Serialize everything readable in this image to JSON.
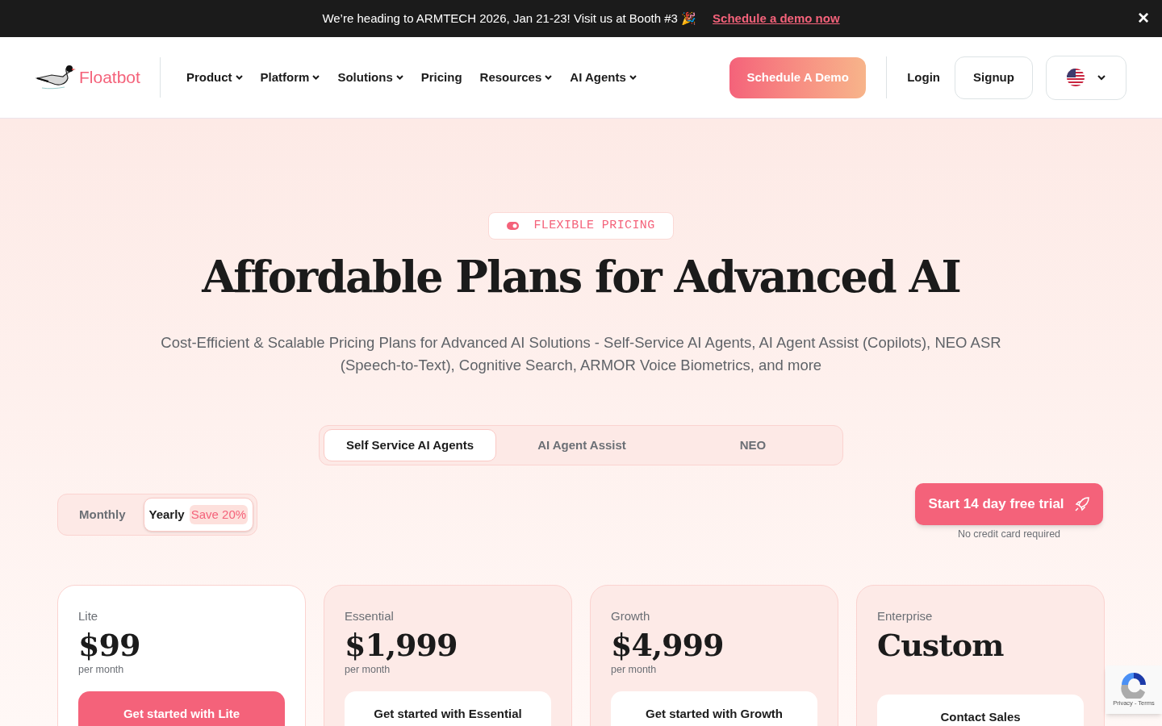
{
  "announcement": {
    "text": "We’re heading to ARMTECH 2026, Jan 21-23! Visit us at Booth #3 🎉",
    "link": "Schedule a demo now",
    "close": "×"
  },
  "header": {
    "brand": "Floatbot",
    "nav": [
      {
        "label": "Product",
        "has_menu": true
      },
      {
        "label": "Platform",
        "has_menu": true
      },
      {
        "label": "Solutions",
        "has_menu": true
      },
      {
        "label": "Pricing",
        "has_menu": false
      },
      {
        "label": "Resources",
        "has_menu": true
      },
      {
        "label": "AI Agents",
        "has_menu": true
      }
    ],
    "demo_button": "Schedule A Demo",
    "login": "Login",
    "signup": "Signup"
  },
  "hero": {
    "badge": "FLEXIBLE PRICING",
    "title": "Affordable Plans for Advanced AI",
    "subtitle": "Cost-Efficient & Scalable Pricing Plans for Advanced AI Solutions - Self-Service AI Agents, AI Agent Assist (Copilots), NEO ASR (Speech-to-Text), Cognitive Search, ARMOR Voice Biometrics, and more"
  },
  "product_tabs": [
    {
      "label": "Self Service AI Agents",
      "selected": true
    },
    {
      "label": "AI Agent Assist",
      "selected": false
    },
    {
      "label": "NEO",
      "selected": false
    }
  ],
  "billing": [
    {
      "label": "Monthly",
      "selected": false
    },
    {
      "label": "Yearly",
      "selected": true,
      "badge": "Save 20%"
    }
  ],
  "trial": {
    "button": "Start 14 day free trial",
    "note": "No credit card required"
  },
  "plans": [
    {
      "name": "Lite",
      "price": "$99",
      "period": "per month",
      "button": "Get started with Lite",
      "highlighted": true
    },
    {
      "name": "Essential",
      "price": "$1,999",
      "period": "per month",
      "button": "Get started with Essential",
      "highlighted": false
    },
    {
      "name": "Growth",
      "price": "$4,999",
      "period": "per month",
      "button": "Get started with Growth",
      "highlighted": false
    },
    {
      "name": "Enterprise",
      "price": "Custom",
      "button": "Contact Sales",
      "highlighted": false
    }
  ],
  "recaptcha": {
    "text": "Privacy - Terms"
  }
}
